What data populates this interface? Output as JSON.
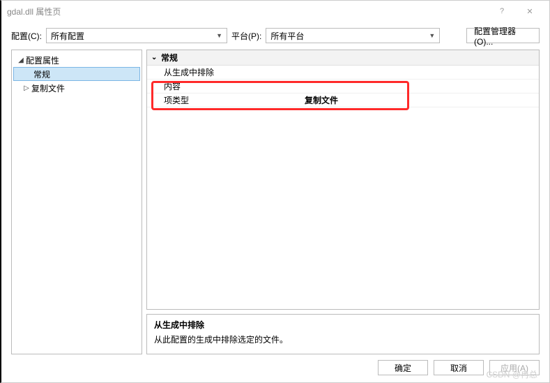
{
  "title": "gdal.dll 属性页",
  "toolbar": {
    "config_label": "配置(C):",
    "config_value": "所有配置",
    "platform_label": "平台(P):",
    "platform_value": "所有平台",
    "cfg_mgr_label": "配置管理器(O)..."
  },
  "tree": {
    "root": "配置属性",
    "node_general": "常规",
    "node_copy": "复制文件"
  },
  "grid": {
    "section": "常规",
    "rows": [
      {
        "label": "从生成中排除",
        "value": ""
      },
      {
        "label": "内容",
        "value": ""
      },
      {
        "label": "项类型",
        "value": "复制文件"
      }
    ]
  },
  "description": {
    "title": "从生成中排除",
    "body": "从此配置的生成中排除选定的文件。"
  },
  "footer": {
    "ok": "确定",
    "cancel": "取消",
    "apply": "应用(A)"
  },
  "watermark": "CSDN @冉总"
}
